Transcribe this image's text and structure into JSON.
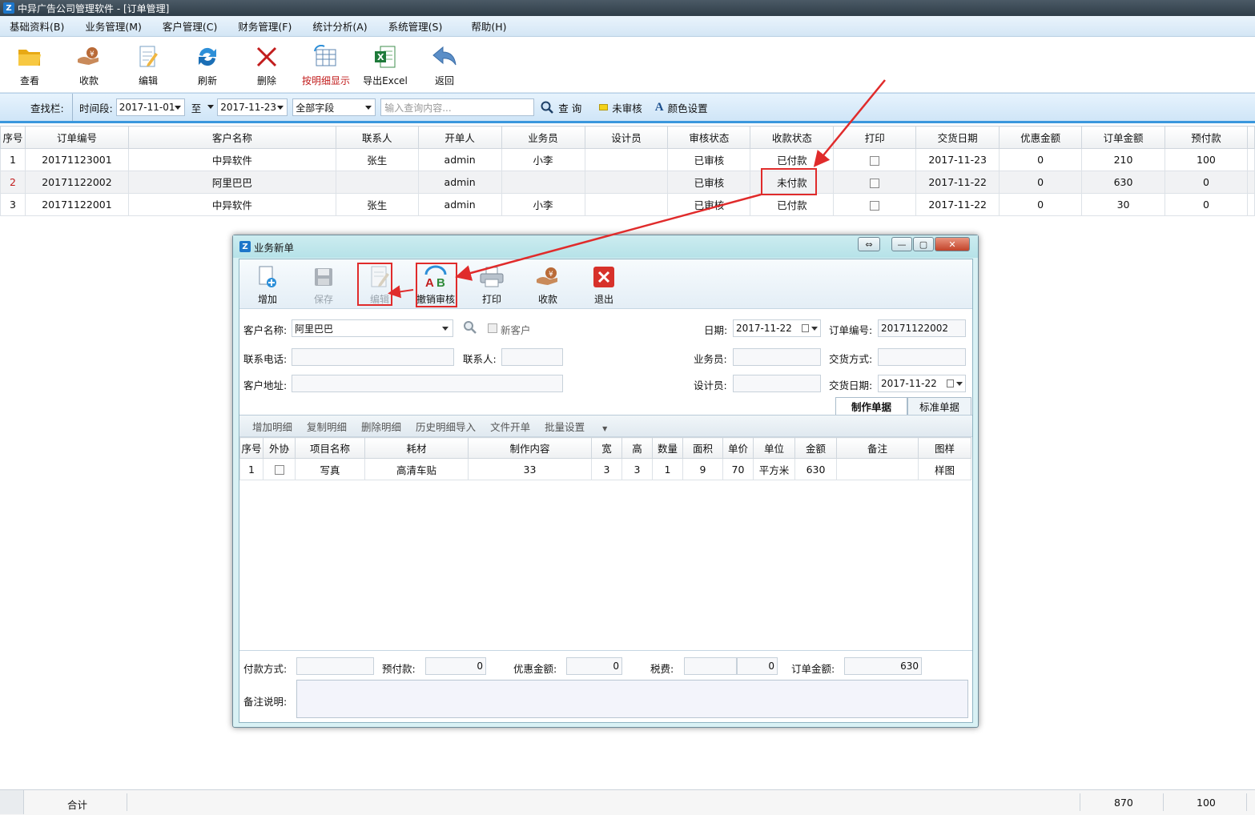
{
  "window": {
    "title": "中异广告公司管理软件 - [订单管理]",
    "logo": "Z"
  },
  "menu": [
    "基础资料(B)",
    "业务管理(M)",
    "客户管理(C)",
    "财务管理(F)",
    "统计分析(A)",
    "系统管理(S)",
    "帮助(H)"
  ],
  "toolbar": {
    "view": "查看",
    "receive": "收款",
    "edit": "编辑",
    "refresh": "刷新",
    "delete": "删除",
    "detail": "按明细显示",
    "export": "导出Excel",
    "back": "返回"
  },
  "search": {
    "bar_label": "查找栏:",
    "period_label": "时间段:",
    "date_from": "2017-11-01",
    "to": "至",
    "date_to": "2017-11-23",
    "field": "全部字段",
    "placeholder": "输入查询内容...",
    "query": "查 询",
    "unreviewed": "未审核",
    "color_settings": "颜色设置"
  },
  "grid": {
    "headers": [
      "序号",
      "订单编号",
      "客户名称",
      "联系人",
      "开单人",
      "业务员",
      "设计员",
      "审核状态",
      "收款状态",
      "打印",
      "交货日期",
      "优惠金额",
      "订单金额",
      "预付款"
    ],
    "rows": [
      [
        "1",
        "20171123001",
        "中异软件",
        "张生",
        "admin",
        "小李",
        "",
        "已审核",
        "已付款",
        "",
        "2017-11-23",
        "0",
        "210",
        "100"
      ],
      [
        "2",
        "20171122002",
        "阿里巴巴",
        "",
        "admin",
        "",
        "",
        "已审核",
        "未付款",
        "",
        "2017-11-22",
        "0",
        "630",
        "0"
      ],
      [
        "3",
        "20171122001",
        "中异软件",
        "张生",
        "admin",
        "小李",
        "",
        "已审核",
        "已付款",
        "",
        "2017-11-22",
        "0",
        "30",
        "0"
      ]
    ]
  },
  "footer": {
    "total_label": "合计",
    "order_total": "870",
    "prepay_total": "100"
  },
  "dialog": {
    "title": "业务新单",
    "toolbar": {
      "add": "增加",
      "save": "保存",
      "edit": "编辑",
      "unreview": "撤销审核",
      "print": "打印",
      "receive": "收款",
      "exit": "退出"
    },
    "form": {
      "customer_label": "客户名称:",
      "customer_value": "阿里巴巴",
      "new_customer": "新客户",
      "date_label": "日期:",
      "date_value": "2017-11-22",
      "order_no_label": "订单编号:",
      "order_no_value": "20171122002",
      "phone_label": "联系电话:",
      "contact_label": "联系人:",
      "salesman_label": "业务员:",
      "delivery_method_label": "交货方式:",
      "address_label": "客户地址:",
      "designer_label": "设计员:",
      "delivery_date_label": "交货日期:",
      "delivery_date_value": "2017-11-22"
    },
    "tabs": [
      "制作单据",
      "标准单据"
    ],
    "sub_toolbar": [
      "增加明细",
      "复制明细",
      "删除明细",
      "历史明细导入",
      "文件开单",
      "批量设置"
    ],
    "detail_headers": [
      "序号",
      "外协",
      "项目名称",
      "耗材",
      "制作内容",
      "宽",
      "高",
      "数量",
      "面积",
      "单价",
      "单位",
      "金额",
      "备注",
      "图样"
    ],
    "detail_rows": [
      [
        "1",
        "",
        "写真",
        "高清车贴",
        "33",
        "3",
        "3",
        "1",
        "9",
        "70",
        "平方米",
        "630",
        "",
        "样图"
      ]
    ],
    "bottom": {
      "payment_method_label": "付款方式:",
      "prepay_label": "预付款:",
      "prepay_value": "0",
      "discount_label": "优惠金额:",
      "discount_value": "0",
      "tax_label": "税费:",
      "tax_value": "0",
      "order_amount_label": "订单金额:",
      "order_amount_value": "630",
      "remark_label": "备注说明:"
    }
  },
  "colors": {
    "accent": "#3a97dd",
    "highlight": "#e02b2b",
    "delete": "#c21d1d",
    "unreviewed_swatch": "#f3d21a"
  }
}
